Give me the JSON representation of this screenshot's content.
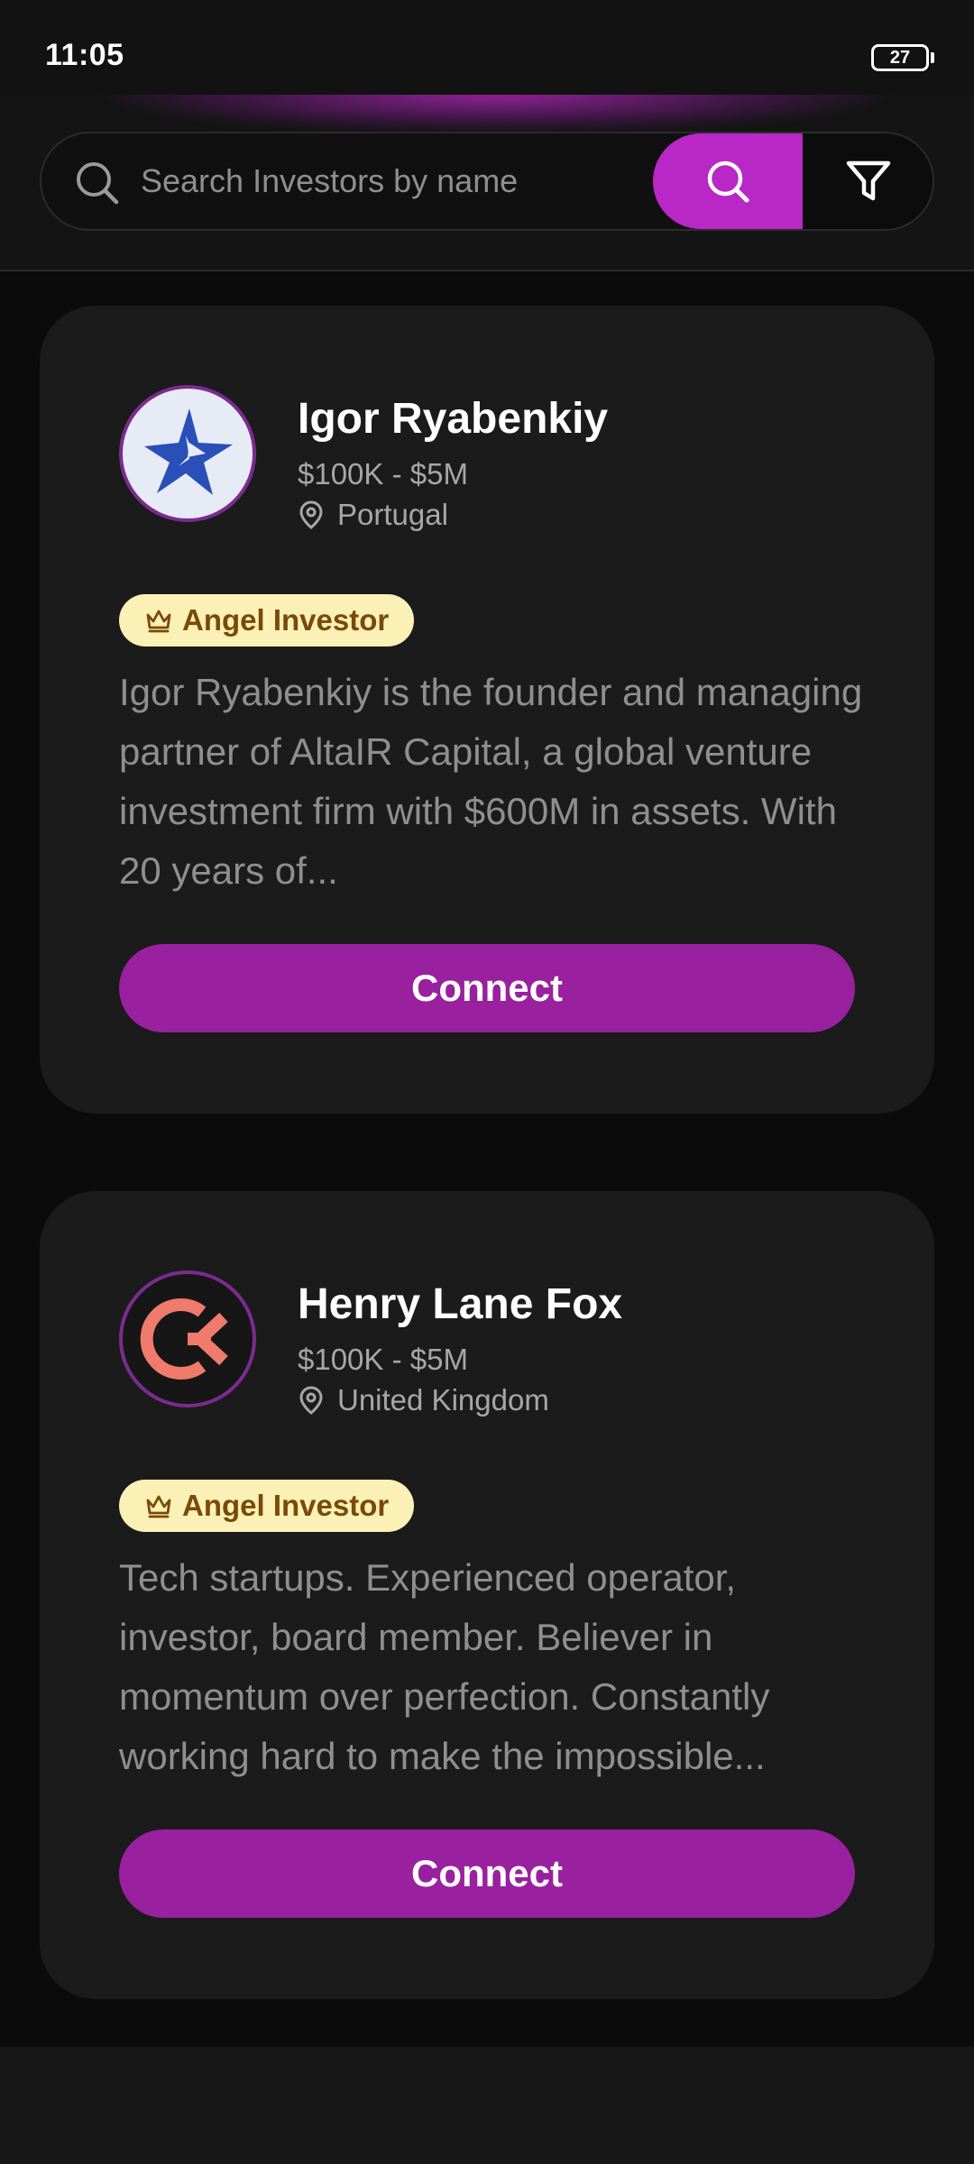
{
  "status_bar": {
    "time": "11:05",
    "battery": "27"
  },
  "search": {
    "placeholder": "Search Investors by name",
    "search_icon": "search-icon",
    "filter_icon": "filter-icon",
    "accent_color": "#b927c6"
  },
  "investors": [
    {
      "name": "Igor Ryabenkiy",
      "range": "$100K - $5M",
      "location": "Portugal",
      "badge": "Angel Investor",
      "description": "Igor Ryabenkiy is the founder and managing partner of AltaIR Capital, a global venture investment firm with $600M in assets. With 20 years of...",
      "connect_label": "Connect",
      "avatar_icon": "star-logo-icon"
    },
    {
      "name": "Henry Lane Fox",
      "range": "$100K - $5M",
      "location": "United Kingdom",
      "badge": "Angel Investor",
      "description": "Tech startups. Experienced operator, investor, board member. Believer in momentum over perfection. Constantly working hard to make the impossible...",
      "connect_label": "Connect",
      "avatar_icon": "cf-logo-icon"
    }
  ],
  "colors": {
    "connect_button": "#99209f",
    "badge_bg": "#fbf1b6",
    "badge_text": "#7a4a06",
    "card_bg": "#1b1b1b"
  }
}
